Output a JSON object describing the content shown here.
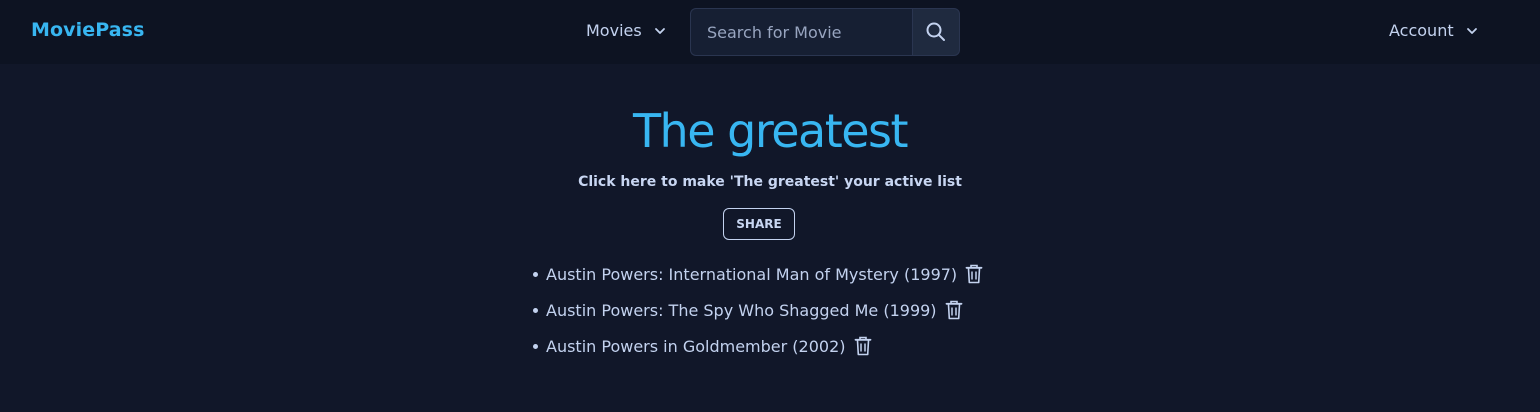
{
  "navbar": {
    "brand": "MoviePass",
    "movies_label": "Movies",
    "search_placeholder": "Search for Movie",
    "account_label": "Account"
  },
  "list": {
    "title": "The greatest",
    "active_link": "Click here to make 'The greatest' your active list",
    "share_label": "SHARE",
    "movies": [
      "Austin Powers: International Man of Mystery (1997)",
      "Austin Powers: The Spy Who Shagged Me (1999)",
      "Austin Powers in Goldmember (2002)"
    ]
  },
  "colors": {
    "background": "#111729",
    "navbar": "#0d1322",
    "accent": "#38b6f1",
    "text": "#c3d2ef"
  },
  "icons": {
    "search": "search-icon",
    "chevron": "chevron-down-icon",
    "delete": "trash-icon"
  }
}
